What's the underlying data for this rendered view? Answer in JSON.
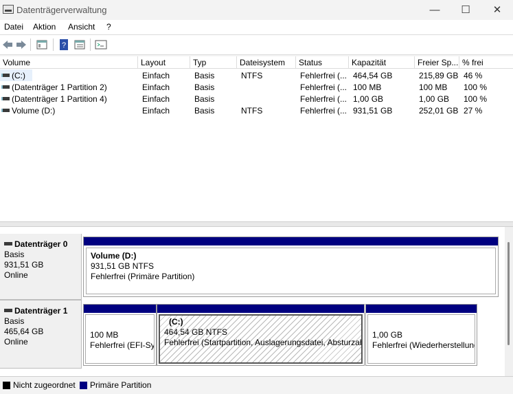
{
  "window": {
    "title": "Datenträgerverwaltung",
    "minimize": "—",
    "maximize": "☐",
    "close": "✕"
  },
  "menu": [
    "Datei",
    "Aktion",
    "Ansicht",
    "?"
  ],
  "toolbar": {
    "icons": [
      "back-icon",
      "forward-icon",
      "properties-icon",
      "help-icon",
      "view-icon",
      "console-icon"
    ]
  },
  "columns": [
    "Volume",
    "Layout",
    "Typ",
    "Dateisystem",
    "Status",
    "Kapazität",
    "Freier Sp...",
    "% frei"
  ],
  "volumes": [
    [
      "(C:)",
      "Einfach",
      "Basis",
      "NTFS",
      "Fehlerfrei (...",
      "464,54 GB",
      "215,89 GB",
      "46 %"
    ],
    [
      "(Datenträger 1 Partition 2)",
      "Einfach",
      "Basis",
      "",
      "Fehlerfrei (...",
      "100 MB",
      "100 MB",
      "100 %"
    ],
    [
      "(Datenträger 1 Partition 4)",
      "Einfach",
      "Basis",
      "",
      "Fehlerfrei (...",
      "1,00 GB",
      "1,00 GB",
      "100 %"
    ],
    [
      "Volume (D:)",
      "Einfach",
      "Basis",
      "NTFS",
      "Fehlerfrei (...",
      "931,51 GB",
      "252,01 GB",
      "27 %"
    ]
  ],
  "disks": [
    {
      "name": "Datenträger 0",
      "type": "Basis",
      "size": "931,51 GB",
      "state": "Online",
      "partitions": [
        {
          "title": "Volume  (D:)",
          "line1": "931,51 GB NTFS",
          "line2": "Fehlerfrei (Primäre Partition)"
        }
      ]
    },
    {
      "name": "Datenträger 1",
      "type": "Basis",
      "size": "465,64 GB",
      "state": "Online",
      "partitions": [
        {
          "title": "",
          "line1": "100 MB",
          "line2": "Fehlerfrei (EFI-Sys"
        },
        {
          "title": "(C:)",
          "line1": "464,54 GB NTFS",
          "line2": "Fehlerfrei (Startpartition, Auslagerungsdatei, Absturzab"
        },
        {
          "title": "",
          "line1": "1,00 GB",
          "line2": "Fehlerfrei (Wiederherstellung"
        }
      ]
    }
  ],
  "legend": [
    {
      "label": "Nicht zugeordnet",
      "color": "#000000"
    },
    {
      "label": "Primäre Partition",
      "color": "#000080"
    }
  ],
  "colors": {
    "primary_partition": "#000080",
    "unallocated": "#000000"
  }
}
